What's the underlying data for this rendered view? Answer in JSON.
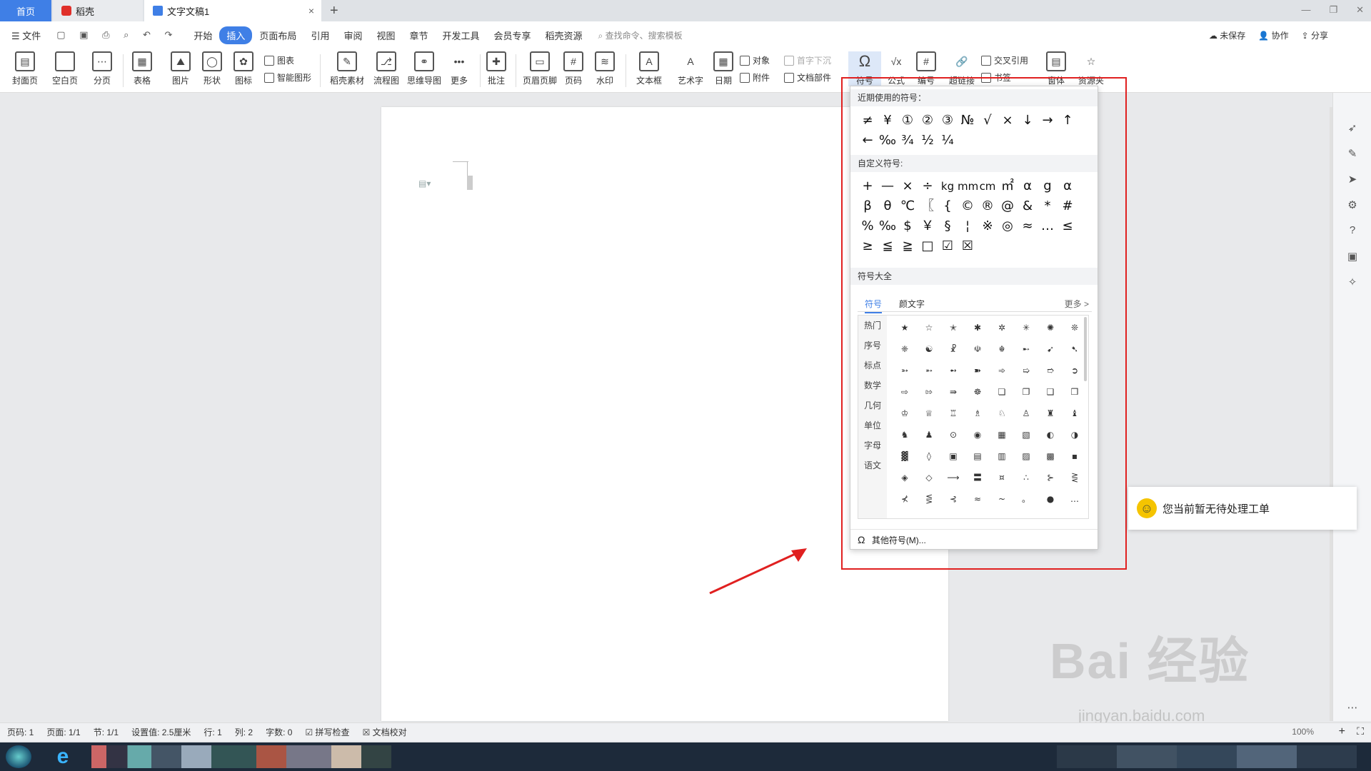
{
  "tabs": {
    "home": "首页",
    "daoke": "稻壳",
    "doc": "文字文稿1",
    "close": "×",
    "new": "+"
  },
  "menu": {
    "file": "文件",
    "items": [
      "开始",
      "插入",
      "页面布局",
      "引用",
      "审阅",
      "视图",
      "章节",
      "开发工具",
      "会员专享",
      "稻壳资源"
    ],
    "active_index": 1,
    "search": "查找命令、搜索模板",
    "unsaved": "未保存",
    "collab": "协作",
    "share": "分享"
  },
  "ribbon": {
    "cover": "封面页",
    "blank": "空白页",
    "pagebreak": "分页",
    "table": "表格",
    "picture": "图片",
    "shape": "形状",
    "icon": "图标",
    "chart": "图表",
    "smartart": "智能图形",
    "daoke_mat": "稻壳素材",
    "flow": "流程图",
    "mindmap": "思维导图",
    "more": "更多",
    "comment": "批注",
    "header_footer": "页眉页脚",
    "page_num": "页码",
    "watermark": "水印",
    "textbox": "文本框",
    "wordart": "艺术字",
    "date": "日期",
    "object": "对象",
    "attach": "附件",
    "dropcap": "首字下沉",
    "docpart": "文档部件",
    "symbol": "符号",
    "formula": "公式",
    "number": "编号",
    "hyperlink": "超链接",
    "crossref": "交叉引用",
    "bookmark": "书签",
    "font": "窗体",
    "resource": "资源夹"
  },
  "panel": {
    "recent_title": "近期使用的符号：",
    "recent": [
      "≠",
      "¥",
      "①",
      "②",
      "③",
      "№",
      "√",
      "×",
      "↓",
      "→",
      "↑",
      "←",
      "‰",
      "¾",
      "½",
      "¼"
    ],
    "custom_title": "自定义符号:",
    "custom": [
      "+",
      "—",
      "×",
      "÷",
      "kg",
      "mm",
      "cm",
      "㎡",
      "α",
      "g",
      "α",
      "β",
      "θ",
      "℃",
      "〖",
      "{",
      "©",
      "®",
      "@",
      "&",
      "*",
      "#",
      "%",
      "‰",
      "$",
      "￥",
      "§",
      "¦",
      "※",
      "◎",
      "≈",
      "…",
      "≤",
      "≥",
      "≦",
      "≧",
      "□",
      "☑",
      "☒"
    ],
    "all_title": "符号大全",
    "tab_symbol": "符号",
    "tab_kaomoji": "颜文字",
    "more": "更多 >",
    "categories": [
      "热门",
      "序号",
      "标点",
      "数学",
      "几何",
      "单位",
      "字母",
      "语文"
    ],
    "grid": [
      "★",
      "☆",
      "✭",
      "✱",
      "✲",
      "✳",
      "✺",
      "❊",
      "❈",
      "☯",
      "☧",
      "☫",
      "☬",
      "➸",
      "➹",
      "➷",
      "➳",
      "➵",
      "➻",
      "➽",
      "➾",
      "➯",
      "➱",
      "➲",
      "⇨",
      "⇰",
      "⇛",
      "☸",
      "❏",
      "❐",
      "❑",
      "❒",
      "♔",
      "♕",
      "♖",
      "♗",
      "♘",
      "♙",
      "♜",
      "♝",
      "♞",
      "♟",
      "⊙",
      "◉",
      "▦",
      "▧",
      "◐",
      "◑",
      "▓",
      "◊",
      "▣",
      "▤",
      "▥",
      "▨",
      "▩",
      "▪",
      "◈",
      "◇",
      "⟶",
      "〓",
      "¤",
      "∴",
      "⊱",
      "⋛",
      "⊀",
      "⋚",
      "⊰",
      "≈",
      "~",
      "。",
      "●",
      "…"
    ],
    "others": "其他符号(M)..."
  },
  "notice": "您当前暂无待处理工单",
  "status": {
    "page": "页码: 1",
    "pages": "页面: 1/1",
    "section": "节: 1/1",
    "setting": "设置值: 2.5厘米",
    "row": "行: 1",
    "col": "列: 2",
    "words": "字数: 0",
    "spell": "拼写检查",
    "proof": "文档校对",
    "zoom": "100%"
  },
  "watermark": {
    "main": "Bai 经验",
    "sub": "jingyan.baidu.com"
  },
  "colors": {
    "accent": "#3f7fe6",
    "red": "#e02020"
  }
}
